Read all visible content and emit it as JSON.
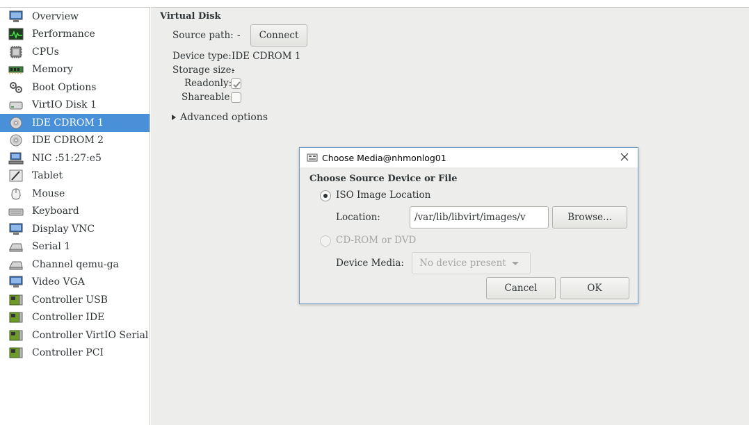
{
  "sidebar": {
    "items": [
      {
        "label": "Overview",
        "icon": "overview-monitor-icon"
      },
      {
        "label": "Performance",
        "icon": "performance-graph-icon"
      },
      {
        "label": "CPUs",
        "icon": "cpu-chip-icon"
      },
      {
        "label": "Memory",
        "icon": "memory-stick-icon"
      },
      {
        "label": "Boot Options",
        "icon": "gears-icon"
      },
      {
        "label": "VirtIO Disk 1",
        "icon": "hard-disk-icon"
      },
      {
        "label": "IDE CDROM 1",
        "icon": "cdrom-icon",
        "selected": true
      },
      {
        "label": "IDE CDROM 2",
        "icon": "cdrom-icon"
      },
      {
        "label": "NIC :51:27:e5",
        "icon": "network-card-icon"
      },
      {
        "label": "Tablet",
        "icon": "tablet-pen-icon"
      },
      {
        "label": "Mouse",
        "icon": "mouse-icon"
      },
      {
        "label": "Keyboard",
        "icon": "keyboard-icon"
      },
      {
        "label": "Display VNC",
        "icon": "display-monitor-icon"
      },
      {
        "label": "Serial 1",
        "icon": "serial-port-icon"
      },
      {
        "label": "Channel qemu-ga",
        "icon": "channel-icon"
      },
      {
        "label": "Video VGA",
        "icon": "video-monitor-icon"
      },
      {
        "label": "Controller USB",
        "icon": "controller-card-icon"
      },
      {
        "label": "Controller IDE",
        "icon": "controller-card-icon"
      },
      {
        "label": "Controller VirtIO Serial",
        "icon": "controller-card-icon"
      },
      {
        "label": "Controller PCI",
        "icon": "controller-card-icon"
      }
    ]
  },
  "details": {
    "section_title": "Virtual Disk",
    "source_path_label": "Source path:",
    "source_path_value": "-",
    "connect_label": "Connect",
    "device_type_label": "Device type:",
    "device_type_value": "IDE CDROM 1",
    "storage_size_label": "Storage size:",
    "storage_size_value": "-",
    "readonly_label": "Readonly:",
    "readonly_checked": true,
    "shareable_label": "Shareable:",
    "shareable_checked": false,
    "advanced_label": "Advanced options"
  },
  "dialog": {
    "title": "Choose Media@nhmonlog01",
    "heading": "Choose Source Device or File",
    "iso_label": "ISO Image Location",
    "location_label": "Location:",
    "location_value": "/var/lib/libvirt/images/v",
    "browse_label": "Browse...",
    "cdrom_label": "CD-ROM or DVD",
    "device_media_label": "Device Media:",
    "device_media_value": "No device present",
    "cancel_label": "Cancel",
    "ok_label": "OK"
  },
  "colors": {
    "selection": "#4a90d9",
    "pane_background": "#ededeb",
    "dialog_border": "#6d9bc8"
  }
}
